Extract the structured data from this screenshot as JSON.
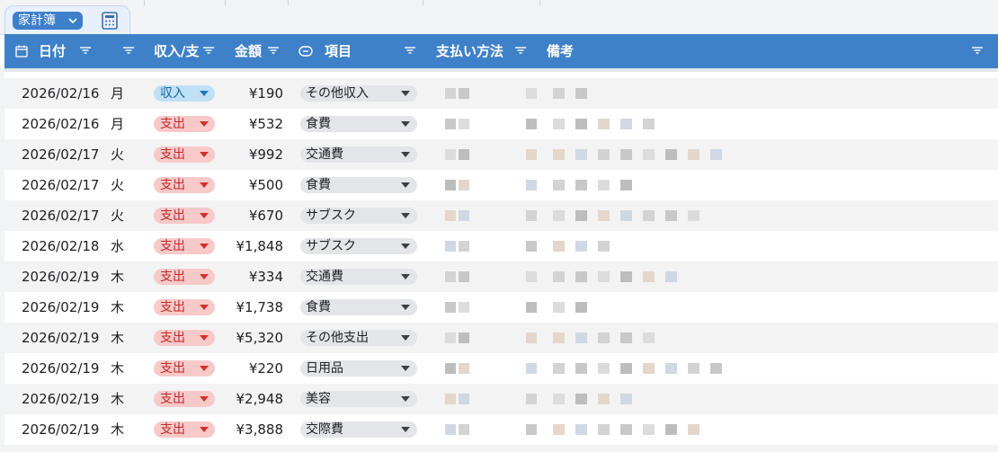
{
  "table_tab": {
    "name": "家計簿",
    "chevron_icon": "chevron-down-icon",
    "calculator_icon": "calculator-icon"
  },
  "header": {
    "date": "日付",
    "type": "収入/支",
    "amount": "金額",
    "category": "項目",
    "payment": "支払い方法",
    "notes": "備考"
  },
  "colors": {
    "header_bg": "#3f81c8",
    "income_chip": "#bfe0f5",
    "expense_chip": "#f8c9c9",
    "category_chip": "#e4e5e9"
  },
  "rows": [
    {
      "date": "2026/02/16",
      "day": "月",
      "type": "収入",
      "kind": "income",
      "amount": "¥190",
      "category": "その他収入"
    },
    {
      "date": "2026/02/16",
      "day": "月",
      "type": "支出",
      "kind": "expense",
      "amount": "¥532",
      "category": "食費"
    },
    {
      "date": "2026/02/17",
      "day": "火",
      "type": "支出",
      "kind": "expense",
      "amount": "¥992",
      "category": "交通費"
    },
    {
      "date": "2026/02/17",
      "day": "火",
      "type": "支出",
      "kind": "expense",
      "amount": "¥500",
      "category": "食費"
    },
    {
      "date": "2026/02/17",
      "day": "火",
      "type": "支出",
      "kind": "expense",
      "amount": "¥670",
      "category": "サブスク"
    },
    {
      "date": "2026/02/18",
      "day": "水",
      "type": "支出",
      "kind": "expense",
      "amount": "¥1,848",
      "category": "サブスク"
    },
    {
      "date": "2026/02/19",
      "day": "木",
      "type": "支出",
      "kind": "expense",
      "amount": "¥334",
      "category": "交通費"
    },
    {
      "date": "2026/02/19",
      "day": "木",
      "type": "支出",
      "kind": "expense",
      "amount": "¥1,738",
      "category": "食費"
    },
    {
      "date": "2026/02/19",
      "day": "木",
      "type": "支出",
      "kind": "expense",
      "amount": "¥5,320",
      "category": "その他支出"
    },
    {
      "date": "2026/02/19",
      "day": "木",
      "type": "支出",
      "kind": "expense",
      "amount": "¥220",
      "category": "日用品"
    },
    {
      "date": "2026/02/19",
      "day": "木",
      "type": "支出",
      "kind": "expense",
      "amount": "¥2,948",
      "category": "美容"
    },
    {
      "date": "2026/02/19",
      "day": "木",
      "type": "支出",
      "kind": "expense",
      "amount": "¥3,888",
      "category": "交際費"
    }
  ]
}
